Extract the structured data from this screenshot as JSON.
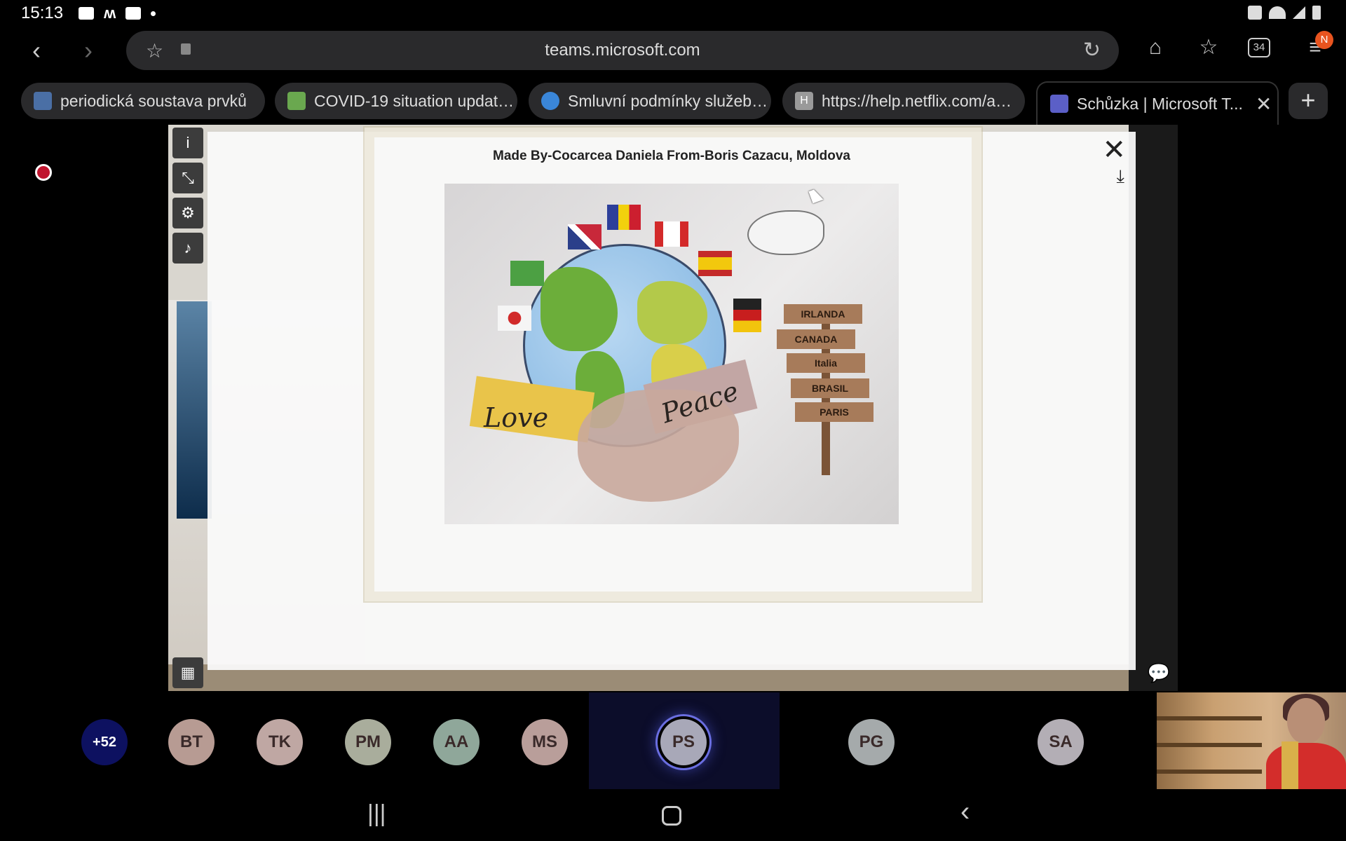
{
  "status_bar": {
    "time": "15:13"
  },
  "browser": {
    "url": "teams.microsoft.com",
    "tab_count": "34",
    "menu_badge": "N",
    "tabs": [
      {
        "label": "periodická soustava prvků",
        "favicon_color": "#4a6fa5"
      },
      {
        "label": "COVID-19 situation updat…",
        "favicon_color": "#6aa84f"
      },
      {
        "label": "Smluvní podmínky služeb…",
        "favicon_color": "#3a86d8"
      },
      {
        "label": "https://help.netflix.com/a…",
        "favicon_color": "#9a9a9a",
        "favicon_letter": "H"
      },
      {
        "label": "Schůzka | Microsoft T...",
        "favicon_color": "#5b5fc7",
        "active": true
      }
    ]
  },
  "viewer": {
    "caption": "Made By-Cocarcea Daniela From-Boris Cazacu, Moldova",
    "artwork": {
      "words": [
        "Love",
        "Peace"
      ],
      "signs": [
        "IRLANDA",
        "CANADA",
        "Italia",
        "BRASIL",
        "PARIS"
      ]
    }
  },
  "participants": {
    "overflow": "+52",
    "people": [
      {
        "initials": "BT",
        "color": "#b79b93"
      },
      {
        "initials": "TK",
        "color": "#bfa7a3"
      },
      {
        "initials": "PM",
        "color": "#a9ad9c"
      },
      {
        "initials": "AA",
        "color": "#8fa79a"
      },
      {
        "initials": "MS",
        "color": "#b99e9a"
      },
      {
        "initials": "PS",
        "color": "#a8a8b8",
        "active": true
      },
      {
        "initials": "PG",
        "color": "#a5aaab"
      },
      {
        "initials": "SA",
        "color": "#b3aeb5"
      }
    ]
  },
  "colors": {
    "overflow_avatar": "#0d1160",
    "record": "#c0142e"
  }
}
